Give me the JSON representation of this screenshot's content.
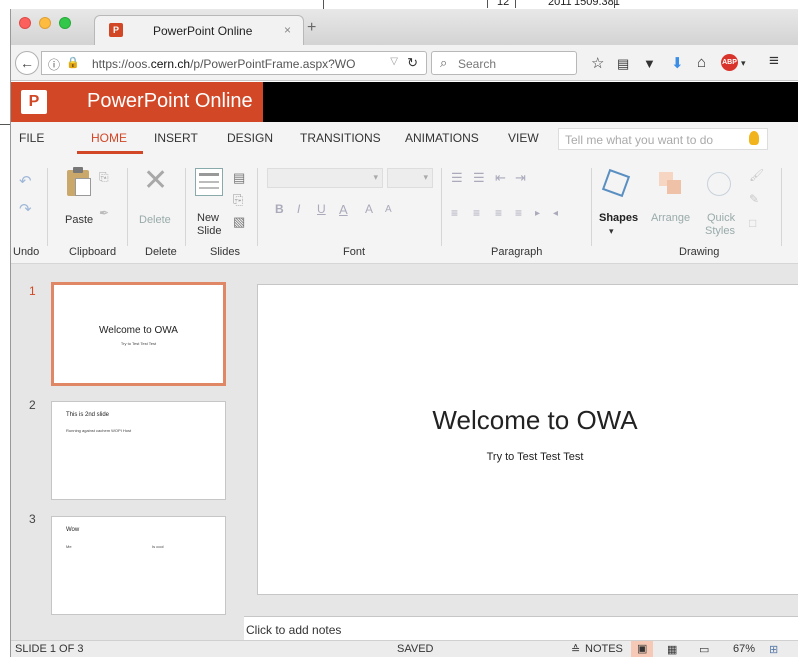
{
  "background_sheet": {
    "col_a": "12",
    "col_b": "2011",
    "col_c": "1509.381"
  },
  "browser": {
    "tab_title": "PowerPoint Online",
    "tab_close": "×",
    "new_tab": "+",
    "url_prefix": "https://oos.",
    "url_host": "cern.ch",
    "url_path": "/p/PowerPointFrame.aspx?WO",
    "search_placeholder": "Search",
    "icons": [
      "star-icon",
      "reading-list-icon",
      "pocket-icon",
      "download-icon",
      "home-icon",
      "adblock-icon",
      "menu-icon"
    ],
    "adblock_label": "ABP"
  },
  "app": {
    "logo_letter": "P",
    "name": "PowerPoint Online",
    "brand_color": "#d24726"
  },
  "ribbon_tabs": [
    "FILE",
    "HOME",
    "INSERT",
    "DESIGN",
    "TRANSITIONS",
    "ANIMATIONS",
    "VIEW"
  ],
  "active_tab": "HOME",
  "tell_me_placeholder": "Tell me what you want to do",
  "ribbon": {
    "paste": "Paste",
    "delete": "Delete",
    "new_slide_1": "New",
    "new_slide_2": "Slide",
    "shapes": "Shapes",
    "arrange": "Arrange",
    "quick_styles_1": "Quick",
    "quick_styles_2": "Styles",
    "font_buttons": [
      "B",
      "I",
      "U",
      "A",
      "A",
      "A"
    ],
    "group_labels": [
      "Undo",
      "Clipboard",
      "Delete",
      "Slides",
      "Font",
      "Paragraph",
      "Drawing"
    ]
  },
  "slides": [
    {
      "number": "1",
      "title": "Welcome to OWA",
      "subtitle": "Try to Test Test Test",
      "selected": true
    },
    {
      "number": "2",
      "title": "This is 2nd slide",
      "bullet": "Running against cachem WOPI Host",
      "selected": false
    },
    {
      "number": "3",
      "title": "Wow",
      "bullet_left": "Me",
      "bullet_right": "Is cool",
      "selected": false
    }
  ],
  "current_slide": {
    "title": "Welcome to OWA",
    "subtitle": "Try to Test Test Test"
  },
  "notes_placeholder": "Click to add notes",
  "status": {
    "slide_info": "SLIDE 1 OF 3",
    "saved": "SAVED",
    "notes": "NOTES",
    "zoom": "67%"
  }
}
